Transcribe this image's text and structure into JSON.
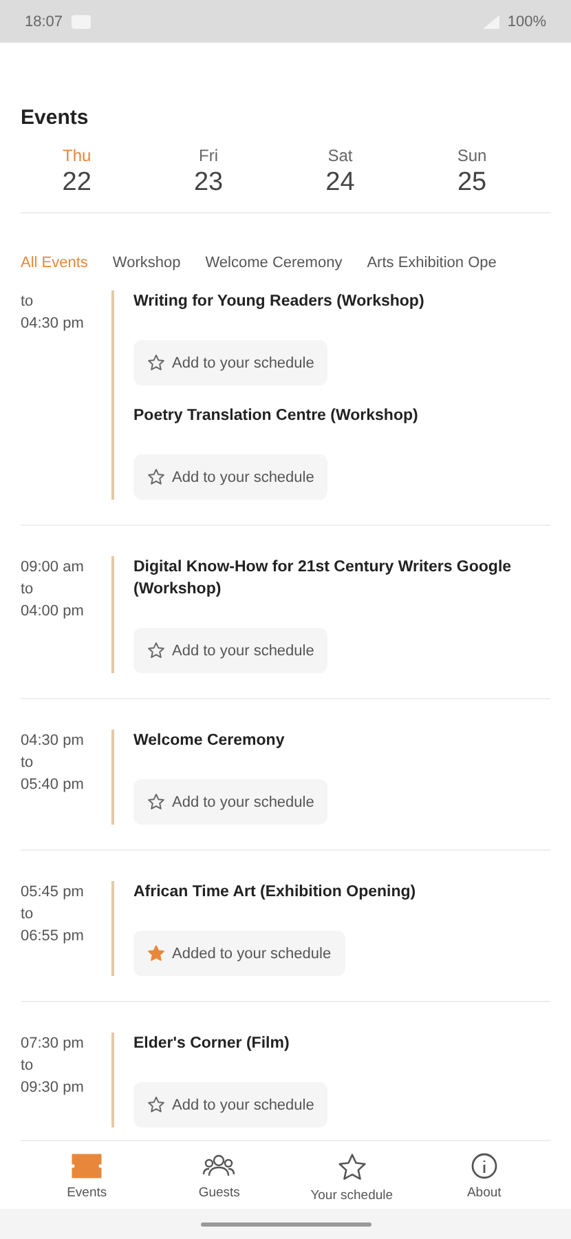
{
  "status_bar": {
    "time": "18:07",
    "battery": "100%"
  },
  "title": "Events",
  "days": [
    {
      "weekday": "Thu",
      "date": "22",
      "selected": true
    },
    {
      "weekday": "Fri",
      "date": "23",
      "selected": false
    },
    {
      "weekday": "Sat",
      "date": "24",
      "selected": false
    },
    {
      "weekday": "Sun",
      "date": "25",
      "selected": false
    }
  ],
  "filters": [
    {
      "label": "All Events",
      "selected": true
    },
    {
      "label": "Workshop",
      "selected": false
    },
    {
      "label": "Welcome Ceremony",
      "selected": false
    },
    {
      "label": "Arts Exhibition Ope",
      "selected": false
    }
  ],
  "groups": [
    {
      "to": "to",
      "end": "04:30 pm",
      "events": [
        {
          "title": "Writing for Young Readers (Workshop)",
          "button": "Add to your schedule",
          "added": false
        },
        {
          "title": "Poetry Translation Centre (Workshop)",
          "button": "Add to your schedule",
          "added": false
        }
      ]
    },
    {
      "start": "09:00 am",
      "to": "to",
      "end": "04:00 pm",
      "events": [
        {
          "title": "Digital Know-How for 21st Century Writers Google (Workshop)",
          "button": "Add to your schedule",
          "added": false
        }
      ]
    },
    {
      "start": "04:30 pm",
      "to": "to",
      "end": "05:40 pm",
      "events": [
        {
          "title": "Welcome Ceremony",
          "button": "Add to your schedule",
          "added": false
        }
      ]
    },
    {
      "start": "05:45 pm",
      "to": "to",
      "end": "06:55 pm",
      "events": [
        {
          "title": "African Time Art (Exhibition Opening)",
          "button": "Added to your schedule",
          "added": true
        }
      ]
    },
    {
      "start": "07:30 pm",
      "to": "to",
      "end": "09:30 pm",
      "events": [
        {
          "title": "Elder's Corner (Film)",
          "button": "Add to your schedule",
          "added": false
        }
      ]
    }
  ],
  "nav": [
    {
      "label": "Events",
      "kind": "events",
      "selected": true
    },
    {
      "label": "Guests",
      "kind": "guests",
      "selected": false
    },
    {
      "label": "Your schedule",
      "kind": "star",
      "selected": false
    },
    {
      "label": "About",
      "kind": "info",
      "selected": false
    }
  ]
}
